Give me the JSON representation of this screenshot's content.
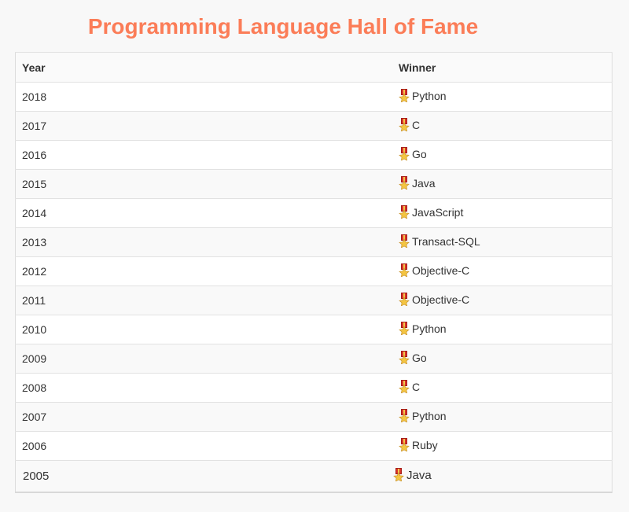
{
  "title": "Programming Language Hall of Fame",
  "table": {
    "headers": [
      "Year",
      "Winner"
    ],
    "icon": "medal-icon",
    "rows": [
      {
        "year": "2018",
        "winner": "Python"
      },
      {
        "year": "2017",
        "winner": "C"
      },
      {
        "year": "2016",
        "winner": "Go"
      },
      {
        "year": "2015",
        "winner": "Java"
      },
      {
        "year": "2014",
        "winner": "JavaScript"
      },
      {
        "year": "2013",
        "winner": "Transact-SQL"
      },
      {
        "year": "2012",
        "winner": "Objective-C"
      },
      {
        "year": "2011",
        "winner": "Objective-C"
      },
      {
        "year": "2010",
        "winner": "Python"
      },
      {
        "year": "2009",
        "winner": "Go"
      },
      {
        "year": "2008",
        "winner": "C"
      },
      {
        "year": "2007",
        "winner": "Python"
      },
      {
        "year": "2006",
        "winner": "Ruby"
      },
      {
        "year": "2005",
        "winner": "Java"
      }
    ]
  }
}
